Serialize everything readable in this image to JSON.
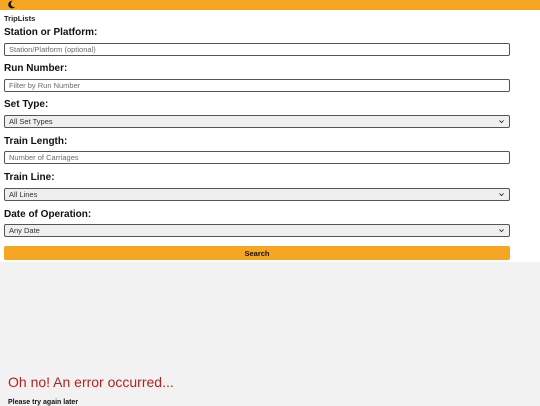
{
  "app": {
    "title": "TripLists",
    "accent_color": "#f5a623",
    "theme_icon": "moon-icon"
  },
  "form": {
    "station": {
      "label": "Station or Platform:",
      "placeholder": "Station/Platform (optional)"
    },
    "run_number": {
      "label": "Run Number:",
      "placeholder": "Filter by Run Number"
    },
    "set_type": {
      "label": "Set Type:",
      "selected": "All Set Types"
    },
    "train_length": {
      "label": "Train Length:",
      "placeholder": "Number of Carriages"
    },
    "train_line": {
      "label": "Train Line:",
      "selected": "All Lines"
    },
    "date": {
      "label": "Date of Operation:",
      "selected": "Any Date"
    },
    "search_label": "Search"
  },
  "error": {
    "title": "Oh no! An error occurred...",
    "message": "Please try again later",
    "color": "#b22222"
  }
}
